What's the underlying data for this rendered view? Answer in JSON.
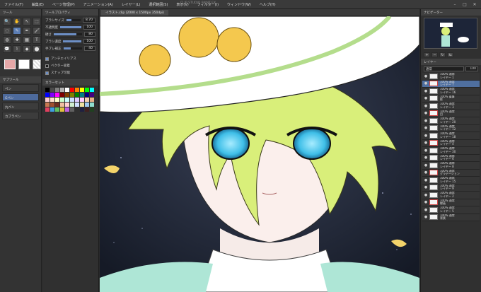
{
  "menu": {
    "items": [
      "ファイル(F)",
      "編集(E)",
      "ページ管理(P)",
      "アニメーション(A)",
      "レイヤー(L)",
      "選択範囲(S)",
      "表示(V)",
      "フィルター(I)",
      "ウィンドウ(W)",
      "ヘルプ(H)"
    ],
    "title": "CLIP STUDIO PAINT EX"
  },
  "tool_panel": {
    "header": "ツール",
    "tools": [
      "🔍",
      "✋",
      "↖",
      "⬚",
      "◌",
      "✎",
      "✒",
      "🖌",
      "◍",
      "✚",
      "▦",
      "T",
      "💬",
      "⌇",
      "◆",
      "⬤"
    ]
  },
  "subtool_panel": {
    "header": "サブツール",
    "items": [
      "ペン",
      "Gペン",
      "丸ペン",
      "カブラペン"
    ],
    "selected_index": 1
  },
  "tool_property": {
    "header": "ツールプロパティ",
    "rows": [
      {
        "label": "ブラシサイズ",
        "value": "8.70",
        "fill": 0.35
      },
      {
        "label": "不透明度",
        "value": "100",
        "fill": 1.0
      },
      {
        "label": "硬さ",
        "value": "80",
        "fill": 0.8
      },
      {
        "label": "ブラシ濃度",
        "value": "100",
        "fill": 1.0
      },
      {
        "label": "手ブレ補正",
        "value": "40",
        "fill": 0.4
      }
    ],
    "checks": [
      {
        "label": "アンチエイリアス",
        "on": true
      },
      {
        "label": "ベクター吸着",
        "on": false
      },
      {
        "label": "スナップ可能",
        "on": true
      }
    ]
  },
  "color_panel": {
    "header": "カラーセット",
    "colors": [
      "#000000",
      "#4a4a4a",
      "#7f7f7f",
      "#b3b3b3",
      "#ffffff",
      "#ff0000",
      "#ff8000",
      "#ffff00",
      "#00ff00",
      "#00ffff",
      "#0000ff",
      "#8000ff",
      "#ff00ff",
      "#800000",
      "#804000",
      "#808000",
      "#008000",
      "#008080",
      "#000080",
      "#400080",
      "#ffcccc",
      "#ffe0cc",
      "#ffffcc",
      "#ccffcc",
      "#ccffff",
      "#cce0ff",
      "#e0ccff",
      "#ffccff",
      "#f5d0b0",
      "#e6b088",
      "#c87850",
      "#a05030",
      "#703020",
      "#f0c0a0",
      "#ffd0d0",
      "#d0f0d0",
      "#d0e0ff",
      "#f0e0a0",
      "#a0c8f0",
      "#90e0d0",
      "#e04060",
      "#40a0e0",
      "#60c060",
      "#e0c040",
      "#c060e0",
      "#606060",
      "#303030",
      "#202040",
      "#402020",
      "#204020"
    ]
  },
  "canvas_tab": {
    "label": "イラスト.clip (2000 x 1500px 350dpi)"
  },
  "navigator": {
    "header": "ナビゲーター"
  },
  "layer_panel": {
    "header": "レイヤー",
    "blend_mode": "通常",
    "opacity": "100",
    "layers": [
      {
        "name": "レイヤー 1",
        "mode": "100% 通常"
      },
      {
        "name": "レイヤー 7",
        "mode": "100% 通常"
      },
      {
        "name": "レイヤー 16",
        "mode": "100% 通常"
      },
      {
        "name": "影",
        "mode": "100% 乗算"
      },
      {
        "name": "レイヤー 3",
        "mode": "100% 通常"
      },
      {
        "name": "目",
        "mode": "100% 通常"
      },
      {
        "name": "レイヤー 20",
        "mode": "100% 通常"
      },
      {
        "name": "レイヤー 12",
        "mode": "100% 通常"
      },
      {
        "name": "レイヤー 18",
        "mode": "100% 通常"
      },
      {
        "name": "レイヤー 4",
        "mode": "100% 通常"
      },
      {
        "name": "レイヤー 30",
        "mode": "100% 通常"
      },
      {
        "name": "レイヤー 6",
        "mode": "100% 通常"
      },
      {
        "name": "レイヤー 8",
        "mode": "100% 通常"
      },
      {
        "name": "グラデーション",
        "mode": "100% 通常"
      },
      {
        "name": "レイヤー 15",
        "mode": "100% 通常"
      },
      {
        "name": "レイヤー 9",
        "mode": "100% 通常"
      },
      {
        "name": "レイヤー 2",
        "mode": "100% 通常"
      },
      {
        "name": "線画",
        "mode": "100% 通常"
      },
      {
        "name": "レイヤー 5",
        "mode": "100% 通常"
      },
      {
        "name": "背景",
        "mode": "100% 通常"
      }
    ],
    "selected_index": 1
  }
}
